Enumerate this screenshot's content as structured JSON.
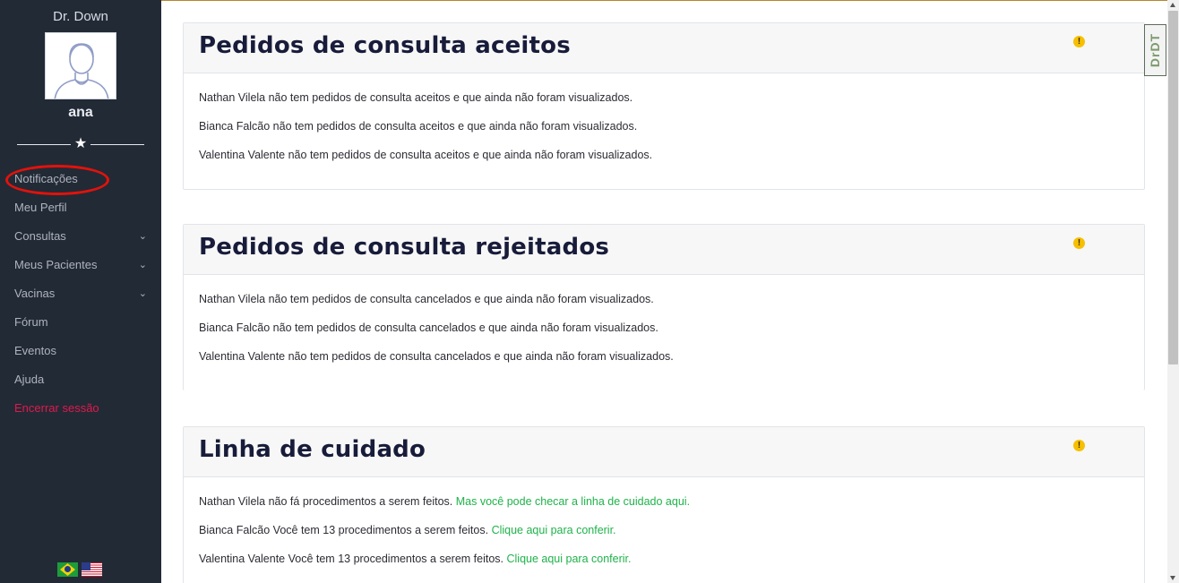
{
  "sidebar": {
    "app_title": "Dr. Down",
    "user_name": "ana",
    "items": [
      {
        "label": "Notificações",
        "has_chevron": false
      },
      {
        "label": "Meu Perfil",
        "has_chevron": false
      },
      {
        "label": "Consultas",
        "has_chevron": true
      },
      {
        "label": "Meus Pacientes",
        "has_chevron": true
      },
      {
        "label": "Vacinas",
        "has_chevron": true
      },
      {
        "label": "Fórum",
        "has_chevron": false
      },
      {
        "label": "Eventos",
        "has_chevron": false
      },
      {
        "label": "Ajuda",
        "has_chevron": false
      },
      {
        "label": "Encerrar sessão",
        "has_chevron": false
      }
    ],
    "chevron_glyph": "⌄",
    "star_glyph": "★",
    "logout_color": "#e0194b",
    "background_color": "#222a36"
  },
  "cards": [
    {
      "title": "Pedidos de consulta aceitos",
      "warn_glyph": "!",
      "lines": [
        {
          "text": "Nathan Vilela não tem pedidos de consulta aceitos e que ainda não foram visualizados.",
          "link": ""
        },
        {
          "text": "Bianca Falcão não tem pedidos de consulta aceitos e que ainda não foram visualizados.",
          "link": ""
        },
        {
          "text": "Valentina Valente não tem pedidos de consulta aceitos e que ainda não foram visualizados.",
          "link": ""
        }
      ]
    },
    {
      "title": "Pedidos de consulta rejeitados",
      "warn_glyph": "!",
      "lines": [
        {
          "text": "Nathan Vilela não tem pedidos de consulta cancelados e que ainda não foram visualizados.",
          "link": ""
        },
        {
          "text": "Bianca Falcão não tem pedidos de consulta cancelados e que ainda não foram visualizados.",
          "link": ""
        },
        {
          "text": "Valentina Valente não tem pedidos de consulta cancelados e que ainda não foram visualizados.",
          "link": ""
        }
      ]
    },
    {
      "title": "Linha de cuidado",
      "warn_glyph": "!",
      "lines": [
        {
          "text": "Nathan Vilela não fá procedimentos a serem feitos. ",
          "link": "Mas você pode checar a linha de cuidado aqui."
        },
        {
          "text": "Bianca Falcão Você tem 13 procedimentos a serem feitos. ",
          "link": "Clique aqui para conferir."
        },
        {
          "text": "Valentina Valente Você tem 13 procedimentos a serem feitos. ",
          "link": "Clique aqui para conferir."
        }
      ]
    }
  ],
  "badge": {
    "text": "DrDT"
  },
  "colors": {
    "link": "#1fb24a",
    "warning": "#f6c000",
    "title": "#181c3a",
    "highlight_ring": "#e3120b",
    "top_accent": "#b8862d"
  },
  "icons": {
    "avatar": "user-avatar-icon",
    "language_pt": "brazil-flag-icon",
    "language_en": "usa-flag-icon",
    "warning": "warning-icon"
  }
}
